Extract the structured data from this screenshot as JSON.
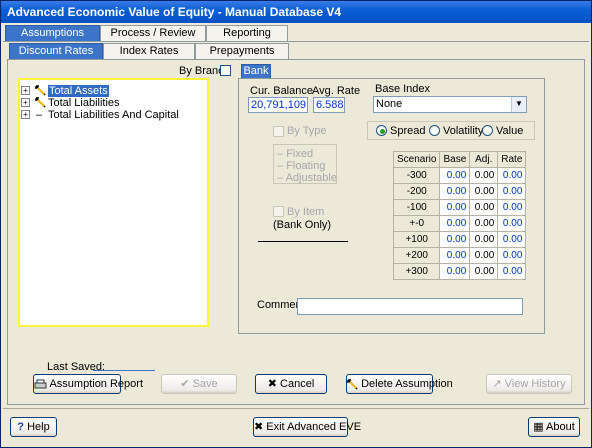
{
  "window": {
    "title": "Advanced Economic Value of Equity - Manual Database V4"
  },
  "main_tabs": [
    {
      "label": "Assumptions"
    },
    {
      "label": "Process / Review"
    },
    {
      "label": "Reporting"
    }
  ],
  "sub_tabs": [
    {
      "label": "Discount Rates"
    },
    {
      "label": "Index Rates"
    },
    {
      "label": "Prepayments"
    }
  ],
  "tree": {
    "by_branch_label": "By Branch",
    "items": [
      {
        "label": "Total Assets",
        "has_icon": true
      },
      {
        "label": "Total Liabilities",
        "has_icon": true
      },
      {
        "label": "Total Liabilities And Capital",
        "has_icon": false
      }
    ]
  },
  "bank_tab": {
    "label": "Bank"
  },
  "balance": {
    "cur_balance_label": "Cur. Balance",
    "cur_balance_value": "20,791,109",
    "avg_rate_label": "Avg. Rate",
    "avg_rate_value": "6.588"
  },
  "base_index": {
    "label": "Base Index",
    "selected": "None"
  },
  "by_type": {
    "label": "By Type",
    "options": [
      {
        "label": "Fixed"
      },
      {
        "label": "Floating"
      },
      {
        "label": "Adjustable"
      }
    ]
  },
  "by_item": {
    "label": "By Item",
    "note": "(Bank Only)"
  },
  "spread_mode": {
    "options": [
      {
        "label": "Spread"
      },
      {
        "label": "Volatility"
      },
      {
        "label": "Value"
      }
    ],
    "selected": "Spread"
  },
  "scenario_table": {
    "headers": [
      "Scenario",
      "Base",
      "Adj.",
      "Rate"
    ],
    "rows": [
      {
        "scenario": "-300",
        "base": "0.00",
        "adj": "0.00",
        "rate": "0.00"
      },
      {
        "scenario": "-200",
        "base": "0.00",
        "adj": "0.00",
        "rate": "0.00"
      },
      {
        "scenario": "-100",
        "base": "0.00",
        "adj": "0.00",
        "rate": "0.00"
      },
      {
        "scenario": "+-0",
        "base": "0.00",
        "adj": "0.00",
        "rate": "0.00"
      },
      {
        "scenario": "+100",
        "base": "0.00",
        "adj": "0.00",
        "rate": "0.00"
      },
      {
        "scenario": "+200",
        "base": "0.00",
        "adj": "0.00",
        "rate": "0.00"
      },
      {
        "scenario": "+300",
        "base": "0.00",
        "adj": "0.00",
        "rate": "0.00"
      }
    ]
  },
  "comment": {
    "label": "Comment:",
    "value": ""
  },
  "last_saved": {
    "label": "Last Saved:",
    "value": ""
  },
  "actions": {
    "assumption_report": "Assumption Report",
    "save": "Save",
    "cancel": "Cancel",
    "delete_assumption": "Delete Assumption",
    "view_history": "View History"
  },
  "footer": {
    "help": "Help",
    "exit": "Exit Advanced EVE",
    "about": "About"
  },
  "colors": {
    "titlebar": "#0A5FD6",
    "active_tab": "#3B74C8",
    "tree_border": "#FFF43C",
    "value_blue": "#0033CC"
  }
}
